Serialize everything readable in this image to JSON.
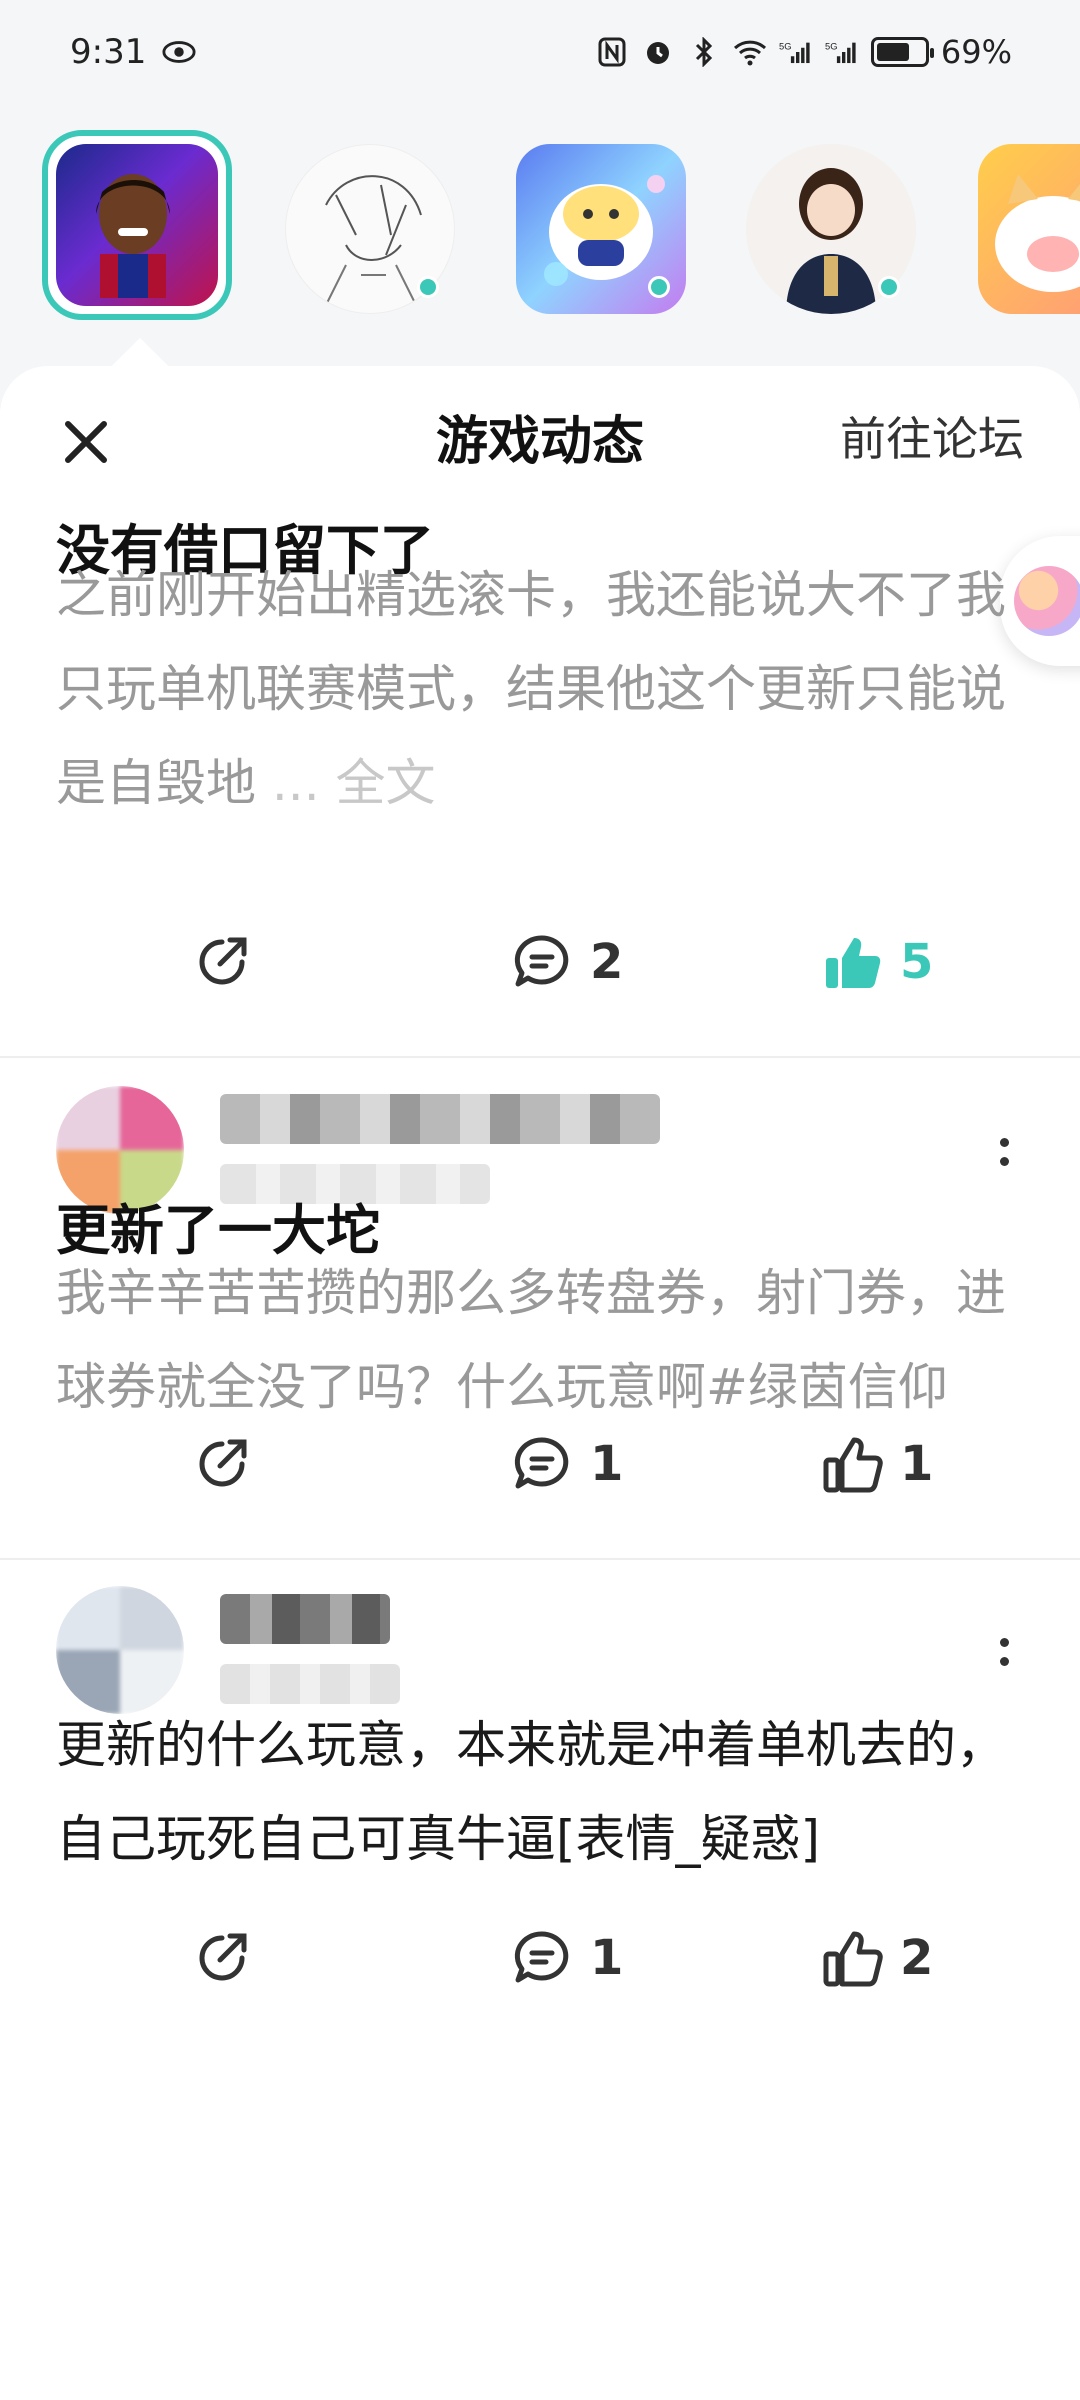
{
  "status_bar": {
    "time": "9:31",
    "battery": "69%",
    "battery_level": 0.69
  },
  "games": [
    {
      "name": "game-avatar-1",
      "selected": true,
      "has_update": false
    },
    {
      "name": "game-avatar-2",
      "selected": false,
      "has_update": true
    },
    {
      "name": "game-avatar-3",
      "selected": false,
      "has_update": true
    },
    {
      "name": "game-avatar-4",
      "selected": false,
      "has_update": true
    },
    {
      "name": "game-avatar-5",
      "selected": false,
      "has_update": false
    }
  ],
  "header": {
    "close_icon": "close-icon",
    "title": "游戏动态",
    "forum_link": "前往论坛"
  },
  "posts": [
    {
      "title": "没有借口留下了",
      "body": "之前刚开始出精选滚卡，我还能说大不了我只玩单机联赛模式，结果他这个更新只能说是自毁地",
      "ellipsis": "...",
      "full_text": "全文",
      "comments": "2",
      "likes": "5",
      "liked": true
    },
    {
      "title": "更新了一大坨",
      "body": "我辛辛苦苦攒的那么多转盘券，射门券，进球券就全没了吗？什么玩意啊#绿茵信仰",
      "comments": "1",
      "likes": "1",
      "liked": false
    },
    {
      "body": "更新的什么玩意，本来就是冲着单机去的，自己玩死自己可真牛逼[表情_疑惑]",
      "comments": "1",
      "likes": "2",
      "liked": false
    }
  ],
  "colors": {
    "accent": "#3cc8b8",
    "muted_text": "#999999"
  }
}
